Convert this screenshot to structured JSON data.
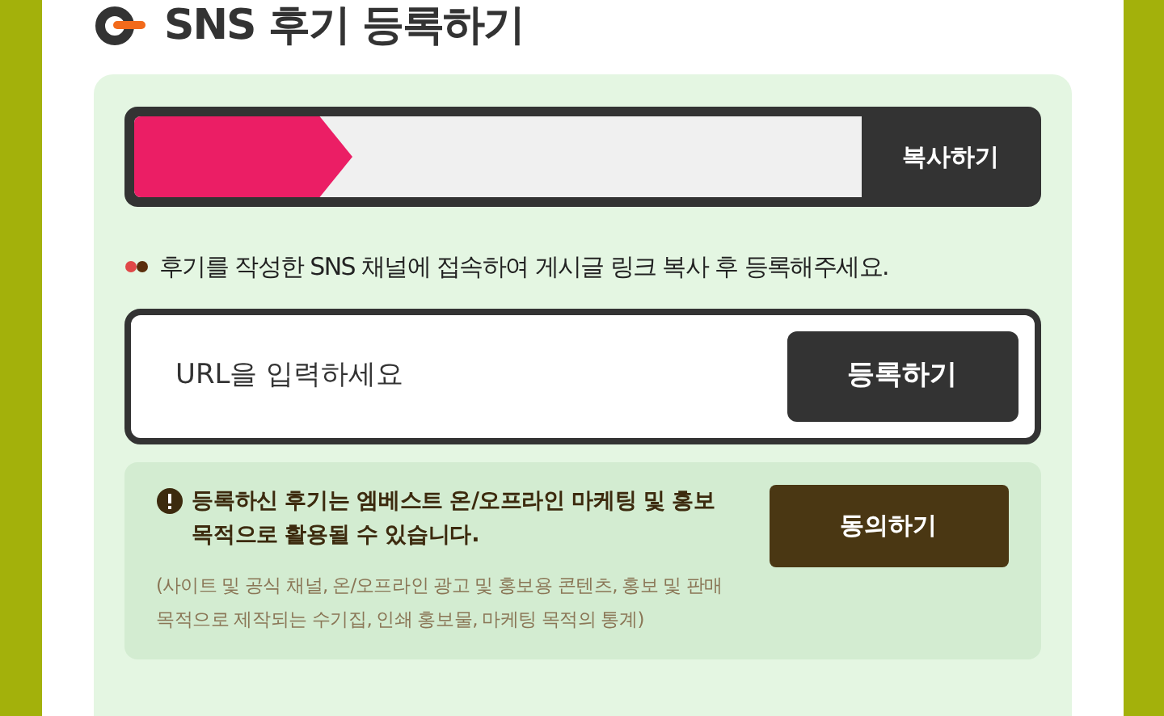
{
  "title": "SNS 후기 등록하기",
  "copy_bar": {
    "level": 0.3,
    "button": "복사하기"
  },
  "instruction": "후기를 작성한 SNS 채널에 접속하여 게시글 링크 복사 후 등록해주세요.",
  "url_field": {
    "placeholder": "URL을 입력하세요",
    "button": "등록하기"
  },
  "notice": {
    "message": "등록하신 후기는 엠베스트 온/오프라인 마케팅 및 홍보 목적으로 활용될 수 있습니다.",
    "detail": "(사이트 및 공식 채널, 온/오프라인 광고 및 홍보용 콘텐츠, 홍보 및 판매 목적으로 제작되는 수기집, 인쇄 홍보물, 마케팅 목적의 통계)",
    "button": "동의하기"
  }
}
